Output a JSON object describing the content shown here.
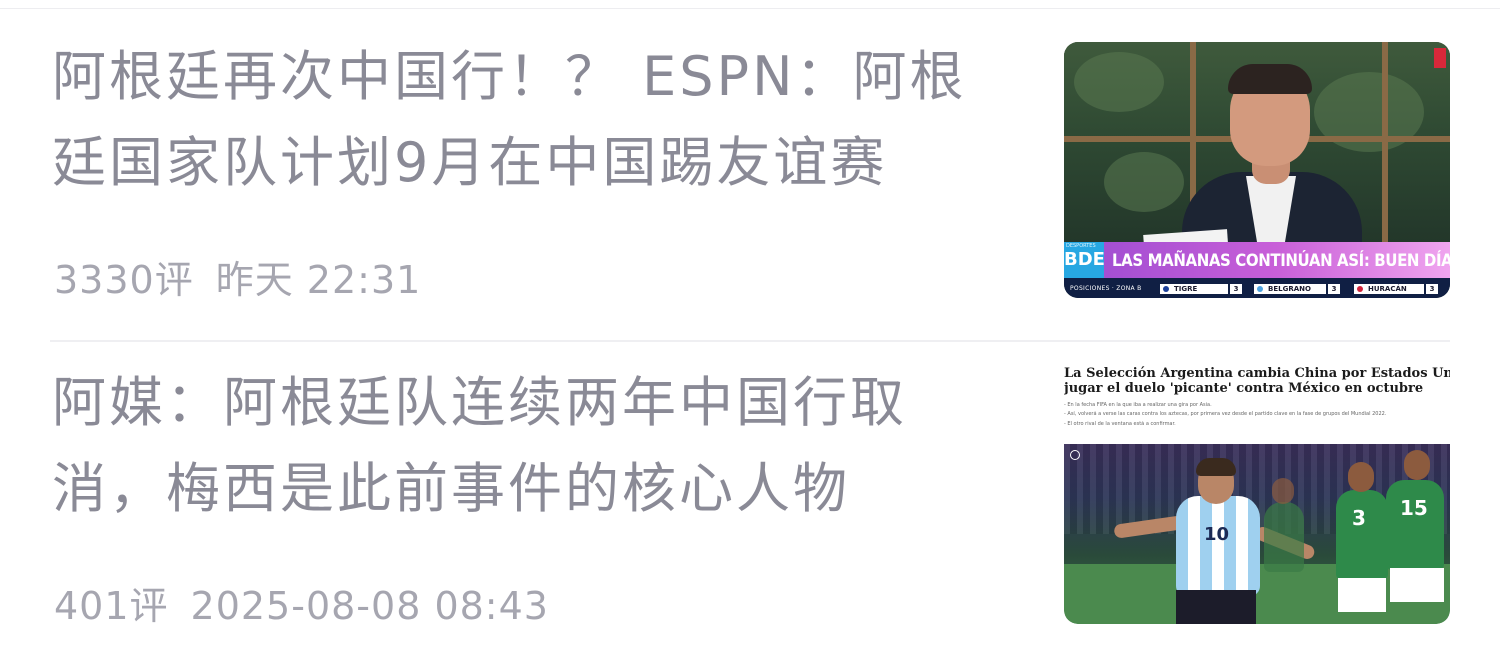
{
  "feed": {
    "items": [
      {
        "headline": "阿根廷再次中国行！？ ESPN：阿根廷国家队计划9月在中国踢友谊赛",
        "comments": "3330评",
        "time": "昨天 22:31",
        "thumbnail": {
          "ticker_logo": "BDE",
          "ticker_logo_sub": "DESPORTES",
          "ticker_text": "LAS MAÑANAS CONTINÚAN ASÍ: BUEN DÍA ESPN",
          "ticker_label": "POSICIONES · ZONA B",
          "standings": [
            {
              "team": "TIGRE",
              "score": "3",
              "color": "#1b3f9a"
            },
            {
              "team": "BELGRANO",
              "score": "3",
              "color": "#4ea3e0"
            },
            {
              "team": "HURACÁN",
              "score": "3",
              "color": "#d1233b"
            }
          ]
        }
      },
      {
        "headline": "阿媒：阿根廷队连续两年中国行取消，梅西是此前事件的核心人物",
        "comments": "401评",
        "time": "2025-08-08 08:43",
        "thumbnail": {
          "article_title_line1": "La Selección Argentina cambia China por Estados Unidos y volverá a",
          "article_title_line2": "jugar el duelo 'picante' contra México en octubre",
          "bullets": [
            "- En la fecha FIFA en la que iba a realizar una gira por Asia.",
            "- Así, volverá a verse las caras contra los aztecas, por primera vez desde el partido clave en la fase de grupos del Mundial 2022.",
            "- El otro rival de la ventana está a confirmar."
          ],
          "player_numbers": {
            "argentina": "10",
            "mexico_a": "3",
            "mexico_b": "15"
          }
        }
      }
    ]
  },
  "colors": {
    "headline": "#8a8a96",
    "meta": "#a6a6b0",
    "divider": "#efeff2",
    "ticker_purple": "#b35bd6",
    "ticker_blue": "#27a7e2"
  }
}
